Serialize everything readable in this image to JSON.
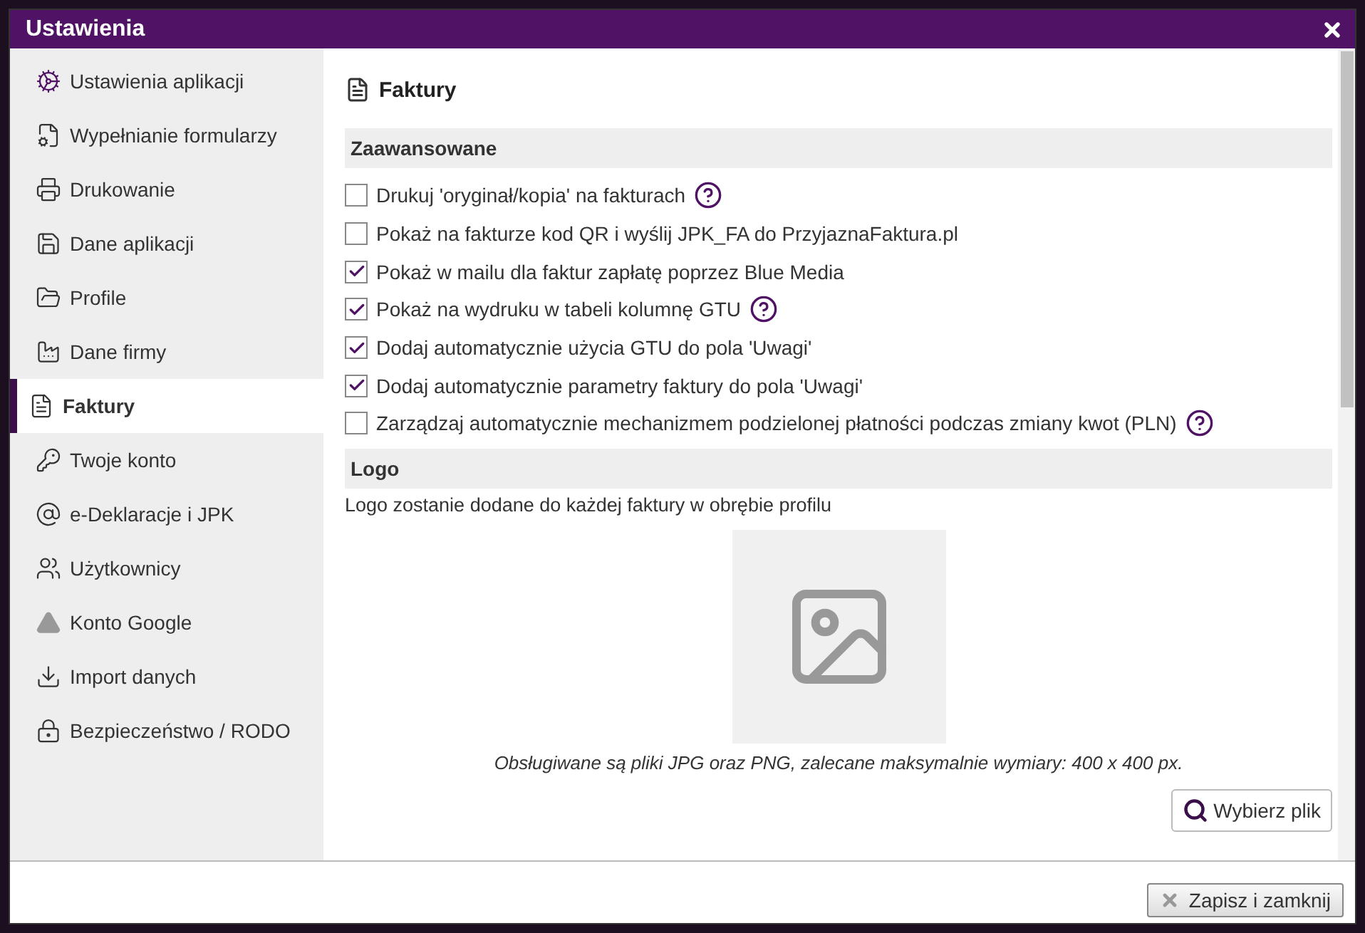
{
  "window": {
    "title": "Ustawienia"
  },
  "sidebar": {
    "items": [
      {
        "label": "Ustawienia aplikacji",
        "selected": false
      },
      {
        "label": "Wypełnianie formularzy",
        "selected": false
      },
      {
        "label": "Drukowanie",
        "selected": false
      },
      {
        "label": "Dane aplikacji",
        "selected": false
      },
      {
        "label": "Profile",
        "selected": false
      },
      {
        "label": "Dane firmy",
        "selected": false
      },
      {
        "label": "Faktury",
        "selected": true
      },
      {
        "label": "Twoje konto",
        "selected": false
      },
      {
        "label": "e-Deklaracje i JPK",
        "selected": false
      },
      {
        "label": "Użytkownicy",
        "selected": false
      },
      {
        "label": "Konto Google",
        "selected": false
      },
      {
        "label": "Import danych",
        "selected": false
      },
      {
        "label": "Bezpieczeństwo / RODO",
        "selected": false
      }
    ]
  },
  "content": {
    "title": "Faktury",
    "advanced": {
      "heading": "Zaawansowane",
      "options": [
        {
          "label": "Drukuj 'oryginał/kopia' na fakturach",
          "checked": false,
          "help": true
        },
        {
          "label": "Pokaż na fakturze kod QR i wyślij JPK_FA do PrzyjaznaFaktura.pl",
          "checked": false,
          "help": false
        },
        {
          "label": "Pokaż w mailu dla faktur zapłatę poprzez Blue Media",
          "checked": true,
          "help": false
        },
        {
          "label": "Pokaż na wydruku w tabeli kolumnę GTU",
          "checked": true,
          "help": true
        },
        {
          "label": "Dodaj automatycznie użycia GTU do pola 'Uwagi'",
          "checked": true,
          "help": false
        },
        {
          "label": "Dodaj automatycznie parametry faktury do pola 'Uwagi'",
          "checked": true,
          "help": false
        },
        {
          "label": "Zarządzaj automatycznie mechanizmem podzielonej płatności podczas zmiany kwot (PLN)",
          "checked": false,
          "help": true
        }
      ]
    },
    "logo": {
      "heading": "Logo",
      "description": "Logo zostanie dodane do każdej faktury w obrębie profilu",
      "hint": "Obsługiwane są pliki JPG oraz PNG, zalecane maksymalnie wymiary: 400 x 400 px.",
      "button": "Wybierz plik"
    }
  },
  "footer": {
    "button": "Zapisz i zamknij"
  }
}
